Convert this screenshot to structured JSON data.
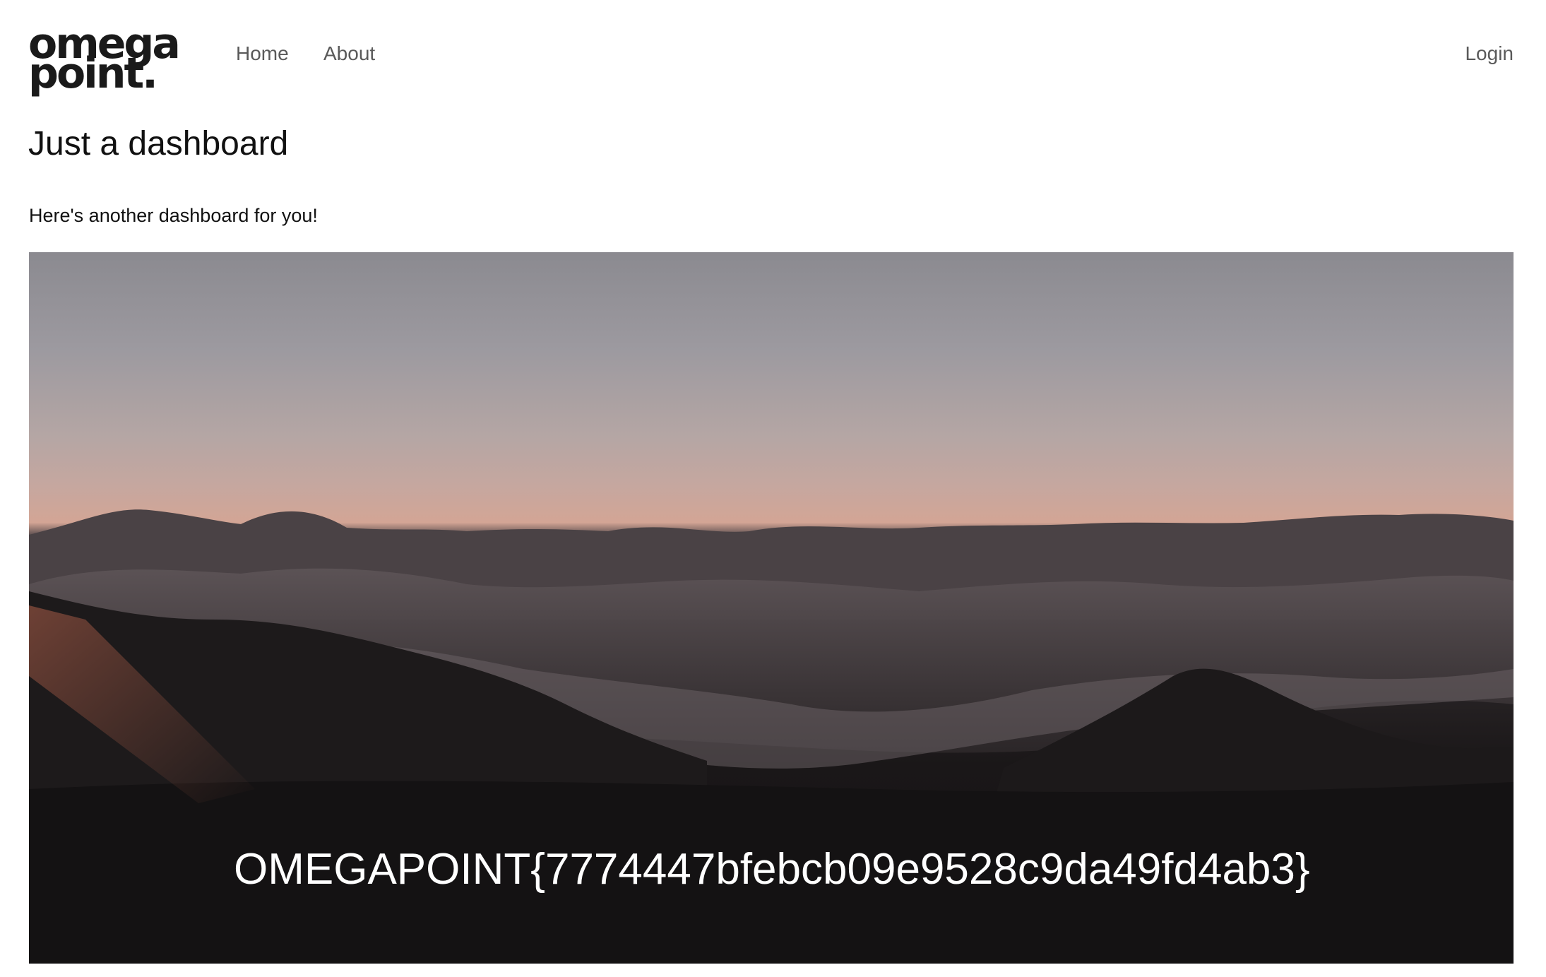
{
  "header": {
    "logo": {
      "line1": "omega",
      "line2": "point."
    },
    "nav": {
      "home_label": "Home",
      "about_label": "About",
      "login_label": "Login"
    }
  },
  "main": {
    "title": "Just a dashboard",
    "intro": "Here's another dashboard for you!",
    "hero": {
      "caption": "OMEGAPOINT{7774447bfebcb09e9528c9da49fd4ab3}"
    }
  },
  "colors": {
    "nav_text": "#5a5a5a",
    "body_text": "#111111",
    "background": "#ffffff",
    "caption_text": "#ffffff"
  }
}
